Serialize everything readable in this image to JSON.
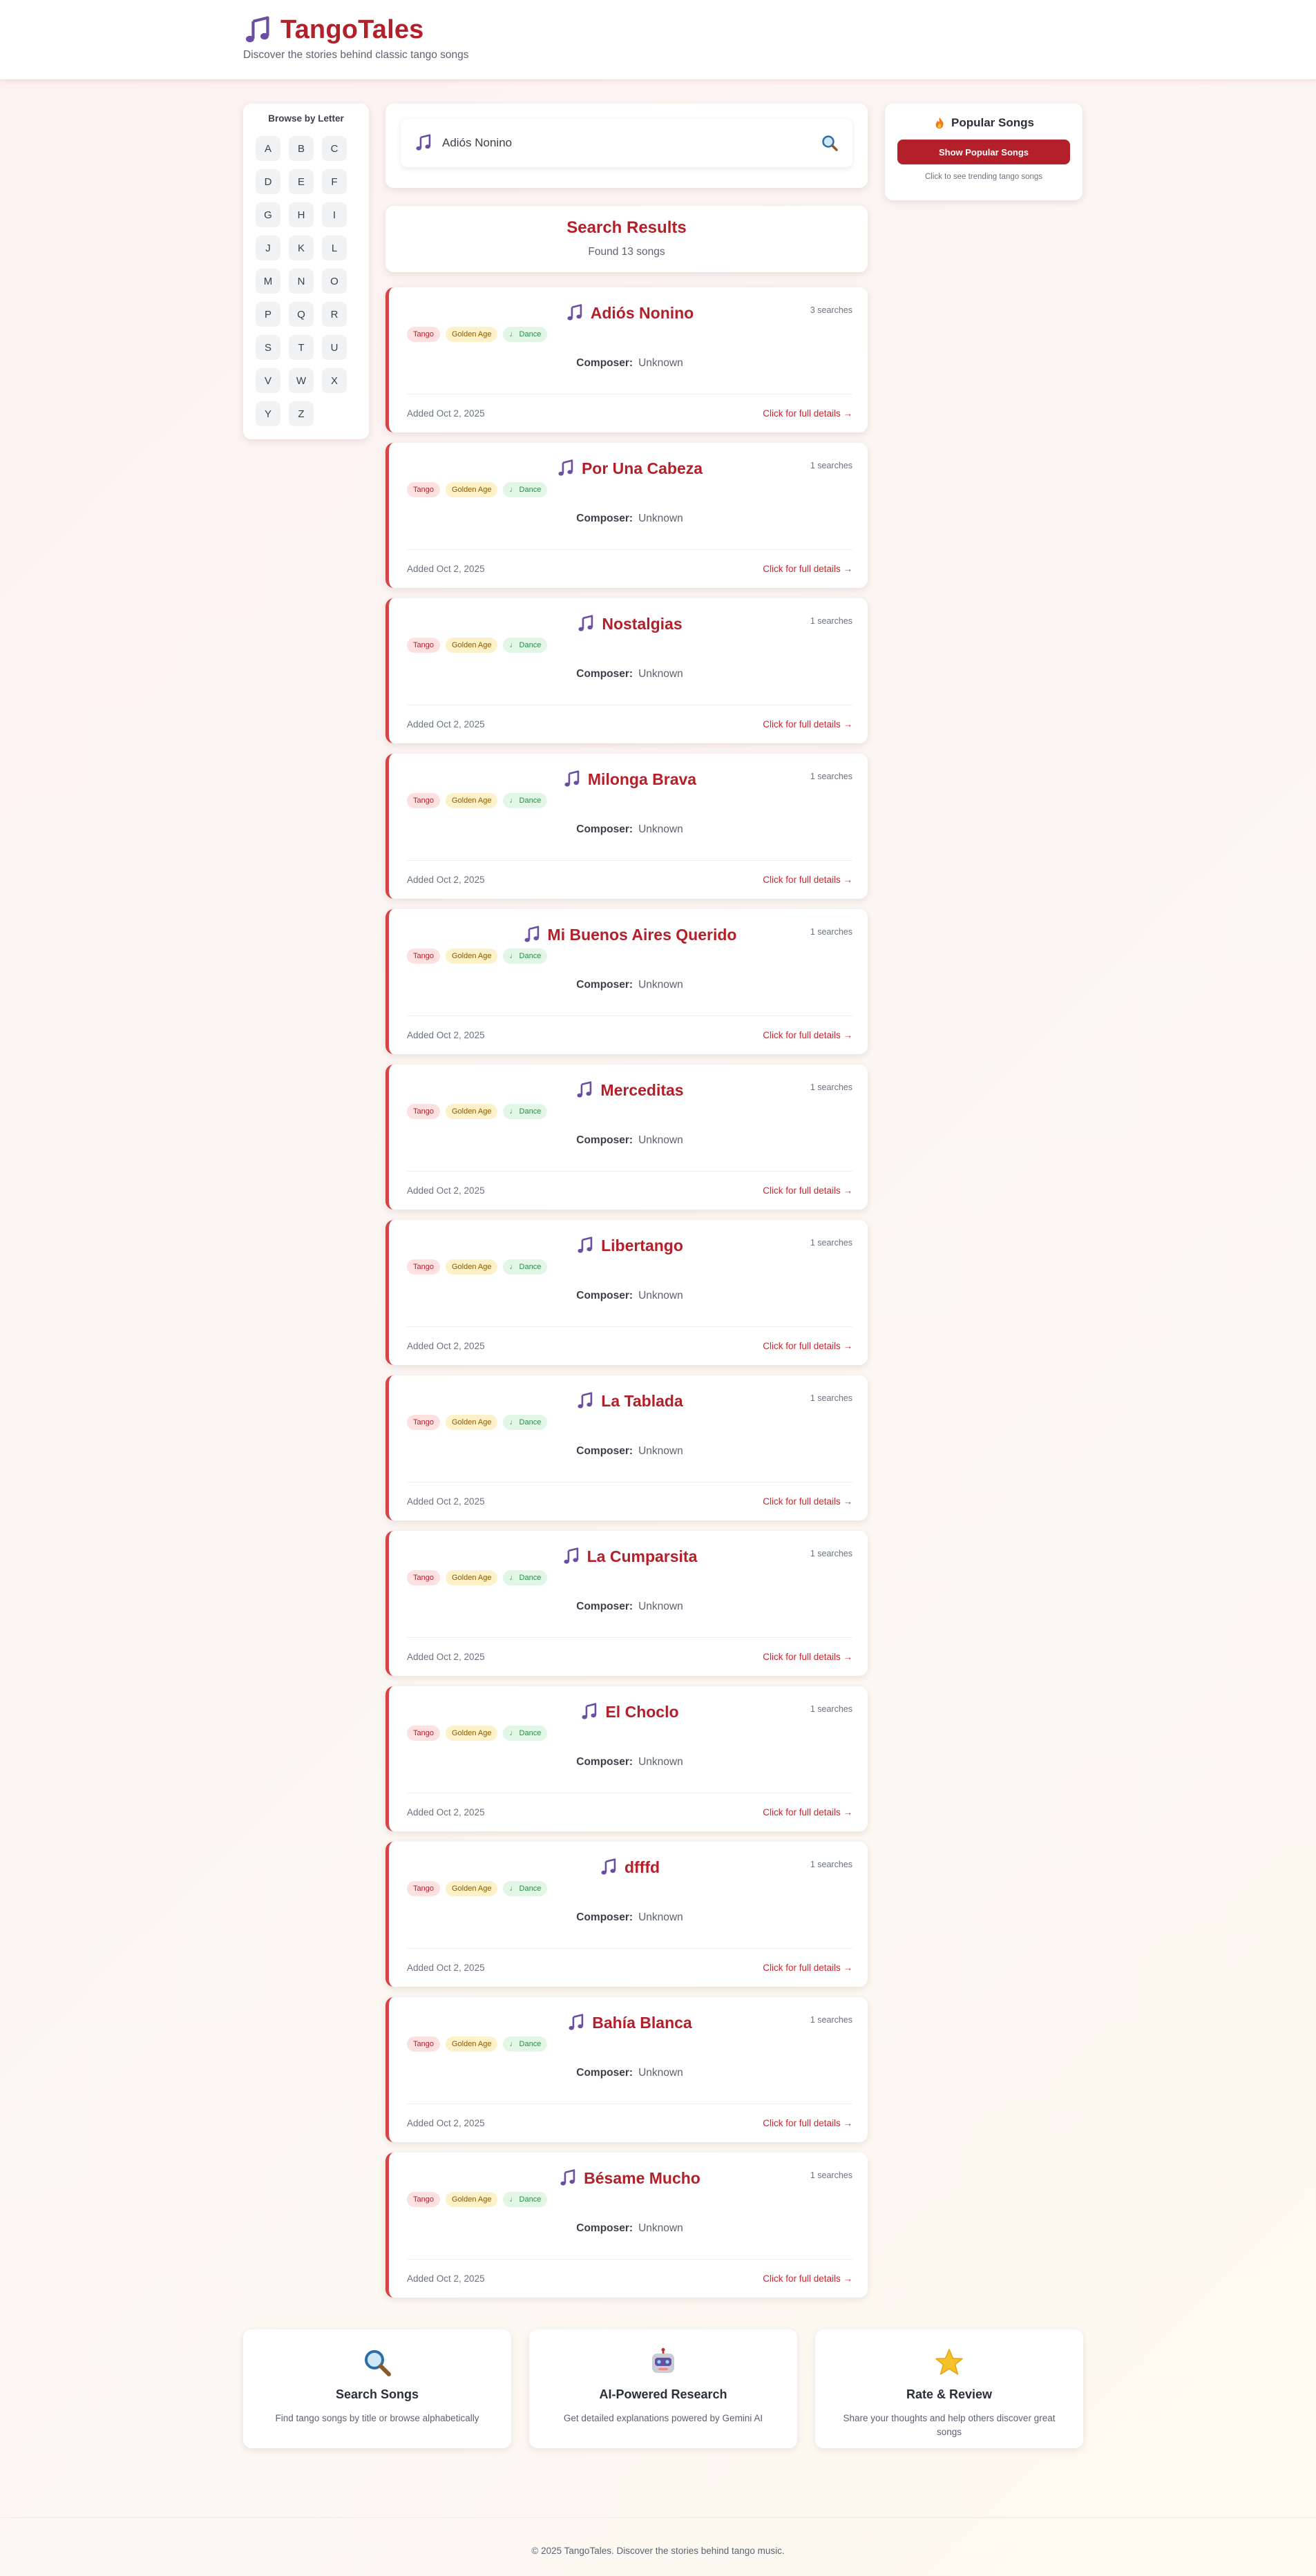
{
  "header": {
    "title": "TangoTales",
    "tagline": "Discover the stories behind classic tango songs"
  },
  "sidebar": {
    "title": "Browse by Letter",
    "letters": [
      "A",
      "B",
      "C",
      "D",
      "E",
      "F",
      "G",
      "H",
      "I",
      "J",
      "K",
      "L",
      "M",
      "N",
      "O",
      "P",
      "Q",
      "R",
      "S",
      "T",
      "U",
      "V",
      "W",
      "X",
      "Y",
      "Z"
    ]
  },
  "search": {
    "value": "Adiós Nonino",
    "button_icon": "search-icon"
  },
  "results": {
    "title": "Search Results",
    "count": "Found 13 songs"
  },
  "song_labels": {
    "composer_label": "Composer:",
    "details_link": "Click for full details →"
  },
  "songs": [
    {
      "title": "Adiós Nonino",
      "searches": "3 searches",
      "tags": [
        "Tango",
        "Golden Age",
        "♩ Dance"
      ],
      "composer": "Unknown",
      "added": "Added Oct 2, 2025"
    },
    {
      "title": "Por Una Cabeza",
      "searches": "1 searches",
      "tags": [
        "Tango",
        "Golden Age",
        "♩ Dance"
      ],
      "composer": "Unknown",
      "added": "Added Oct 2, 2025"
    },
    {
      "title": "Nostalgias",
      "searches": "1 searches",
      "tags": [
        "Tango",
        "Golden Age",
        "♩ Dance"
      ],
      "composer": "Unknown",
      "added": "Added Oct 2, 2025"
    },
    {
      "title": "Milonga Brava",
      "searches": "1 searches",
      "tags": [
        "Tango",
        "Golden Age",
        "♩ Dance"
      ],
      "composer": "Unknown",
      "added": "Added Oct 2, 2025"
    },
    {
      "title": "Mi Buenos Aires Querido",
      "searches": "1 searches",
      "tags": [
        "Tango",
        "Golden Age",
        "♩ Dance"
      ],
      "composer": "Unknown",
      "added": "Added Oct 2, 2025"
    },
    {
      "title": "Merceditas",
      "searches": "1 searches",
      "tags": [
        "Tango",
        "Golden Age",
        "♩ Dance"
      ],
      "composer": "Unknown",
      "added": "Added Oct 2, 2025"
    },
    {
      "title": "Libertango",
      "searches": "1 searches",
      "tags": [
        "Tango",
        "Golden Age",
        "♩ Dance"
      ],
      "composer": "Unknown",
      "added": "Added Oct 2, 2025"
    },
    {
      "title": "La Tablada",
      "searches": "1 searches",
      "tags": [
        "Tango",
        "Golden Age",
        "♩ Dance"
      ],
      "composer": "Unknown",
      "added": "Added Oct 2, 2025"
    },
    {
      "title": "La Cumparsita",
      "searches": "1 searches",
      "tags": [
        "Tango",
        "Golden Age",
        "♩ Dance"
      ],
      "composer": "Unknown",
      "added": "Added Oct 2, 2025"
    },
    {
      "title": "El Choclo",
      "searches": "1 searches",
      "tags": [
        "Tango",
        "Golden Age",
        "♩ Dance"
      ],
      "composer": "Unknown",
      "added": "Added Oct 2, 2025"
    },
    {
      "title": "dfffd",
      "searches": "1 searches",
      "tags": [
        "Tango",
        "Golden Age",
        "♩ Dance"
      ],
      "composer": "Unknown",
      "added": "Added Oct 2, 2025"
    },
    {
      "title": "Bahía Blanca",
      "searches": "1 searches",
      "tags": [
        "Tango",
        "Golden Age",
        "♩ Dance"
      ],
      "composer": "Unknown",
      "added": "Added Oct 2, 2025"
    },
    {
      "title": "Bésame Mucho",
      "searches": "1 searches",
      "tags": [
        "Tango",
        "Golden Age",
        "♩ Dance"
      ],
      "composer": "Unknown",
      "added": "Added Oct 2, 2025"
    }
  ],
  "popular": {
    "title": "Popular Songs",
    "button": "Show Popular Songs",
    "hint": "Click to see trending tango songs"
  },
  "features": [
    {
      "icon": "magnifier-icon",
      "title": "Search Songs",
      "desc": "Find tango songs by title or browse alphabetically"
    },
    {
      "icon": "robot-icon",
      "title": "AI-Powered Research",
      "desc": "Get detailed explanations powered by Gemini AI"
    },
    {
      "icon": "star-icon",
      "title": "Rate & Review",
      "desc": "Share your thoughts and help others discover great songs"
    }
  ],
  "footer": {
    "copyright": "© 2025 TangoTales. Discover the stories behind tango music."
  },
  "colors": {
    "brand": "#b3202a",
    "accent_border": "#d64545",
    "note_icon": "#6a4fa0"
  }
}
